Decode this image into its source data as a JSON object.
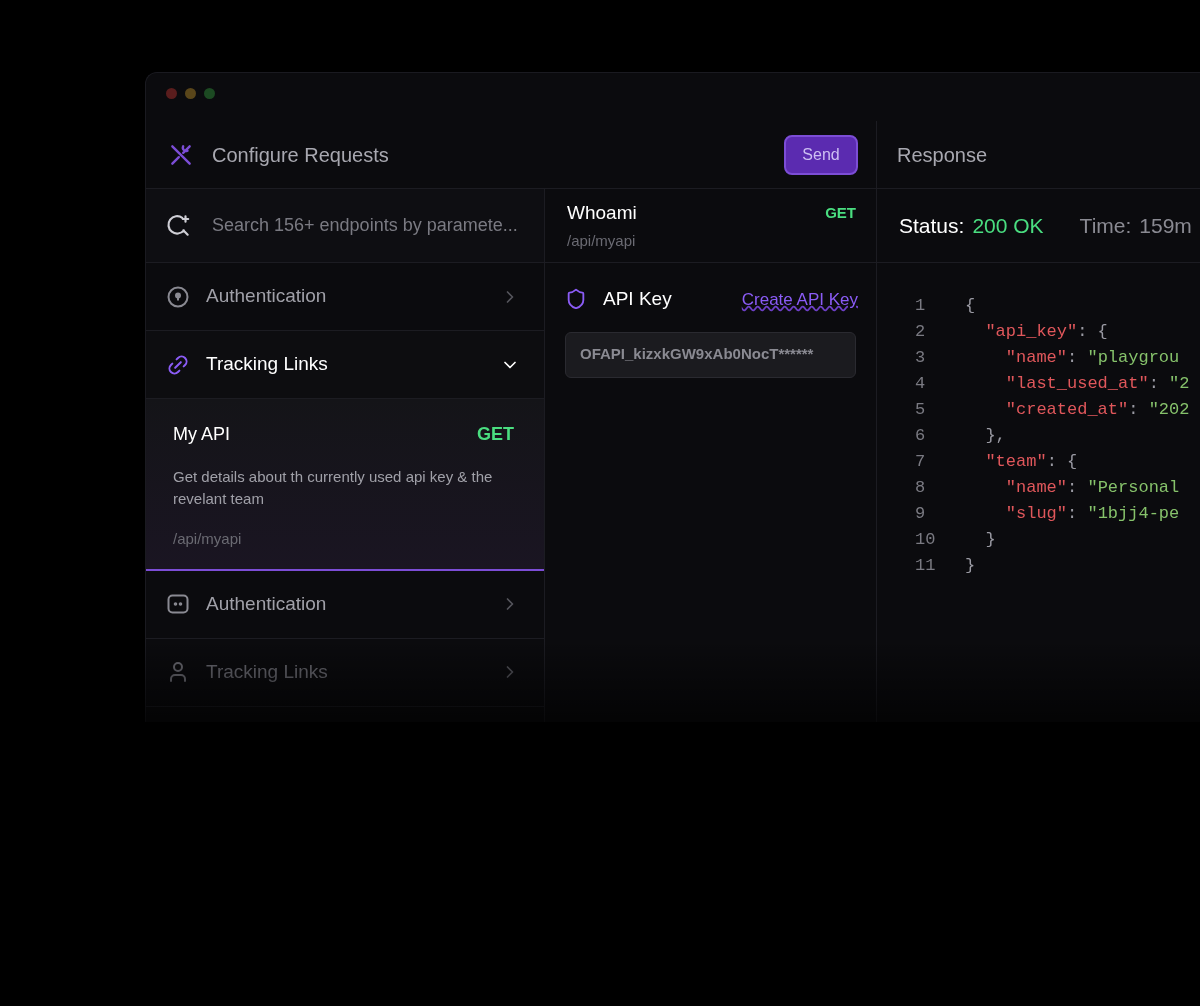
{
  "window": {
    "title": "Configure Requests",
    "send_button": "Send"
  },
  "search": {
    "placeholder": "Search 156+ endpoints by paramete..."
  },
  "sidebar": {
    "items": [
      {
        "label": "Authentication",
        "expanded": false
      },
      {
        "label": "Tracking Links",
        "expanded": true,
        "children": [
          {
            "title": "My API",
            "method": "GET",
            "description": "Get details about th currently used api key & the revelant team",
            "path": "/api/myapi",
            "selected": true
          }
        ]
      },
      {
        "label": "Authentication",
        "expanded": false
      },
      {
        "label": "Tracking Links",
        "expanded": false
      }
    ]
  },
  "request": {
    "title": "Whoami",
    "method": "GET",
    "path": "/api/myapi",
    "auth_label": "API Key",
    "auth_link": "Create API Key",
    "api_key_value": "OFAPI_kizxkGW9xAb0NocT******"
  },
  "response": {
    "title": "Response",
    "status_label": "Status:",
    "status_value": "200 OK",
    "time_label": "Time:",
    "time_value": "159m",
    "lines": [
      {
        "number": "1",
        "tokens": [
          {
            "kind": "punct",
            "text": "{"
          }
        ]
      },
      {
        "number": "2",
        "tokens": [
          {
            "kind": "key",
            "text": "  \"api_key\""
          },
          {
            "kind": "punct",
            "text": ": {"
          }
        ]
      },
      {
        "number": "3",
        "tokens": [
          {
            "kind": "key",
            "text": "    \"name\""
          },
          {
            "kind": "punct",
            "text": ": "
          },
          {
            "kind": "string",
            "text": "\"playgrou"
          }
        ]
      },
      {
        "number": "4",
        "tokens": [
          {
            "kind": "key",
            "text": "    \"last_used_at\""
          },
          {
            "kind": "punct",
            "text": ": "
          },
          {
            "kind": "string",
            "text": "\"2"
          }
        ]
      },
      {
        "number": "5",
        "tokens": [
          {
            "kind": "key",
            "text": "    \"created_at\""
          },
          {
            "kind": "punct",
            "text": ": "
          },
          {
            "kind": "string",
            "text": "\"202"
          }
        ]
      },
      {
        "number": "6",
        "tokens": [
          {
            "kind": "punct",
            "text": "  },"
          }
        ]
      },
      {
        "number": "7",
        "tokens": [
          {
            "kind": "key",
            "text": "  \"team\""
          },
          {
            "kind": "punct",
            "text": ": {"
          }
        ]
      },
      {
        "number": "8",
        "tokens": [
          {
            "kind": "key",
            "text": "    \"name\""
          },
          {
            "kind": "punct",
            "text": ": "
          },
          {
            "kind": "string",
            "text": "\"Personal"
          }
        ]
      },
      {
        "number": "9",
        "tokens": [
          {
            "kind": "key",
            "text": "    \"slug\""
          },
          {
            "kind": "punct",
            "text": ": "
          },
          {
            "kind": "string",
            "text": "\"1bjj4-pe"
          }
        ]
      },
      {
        "number": "10",
        "tokens": [
          {
            "kind": "punct",
            "text": "  }"
          }
        ]
      },
      {
        "number": "11",
        "tokens": [
          {
            "kind": "punct",
            "text": "}"
          }
        ]
      }
    ]
  }
}
